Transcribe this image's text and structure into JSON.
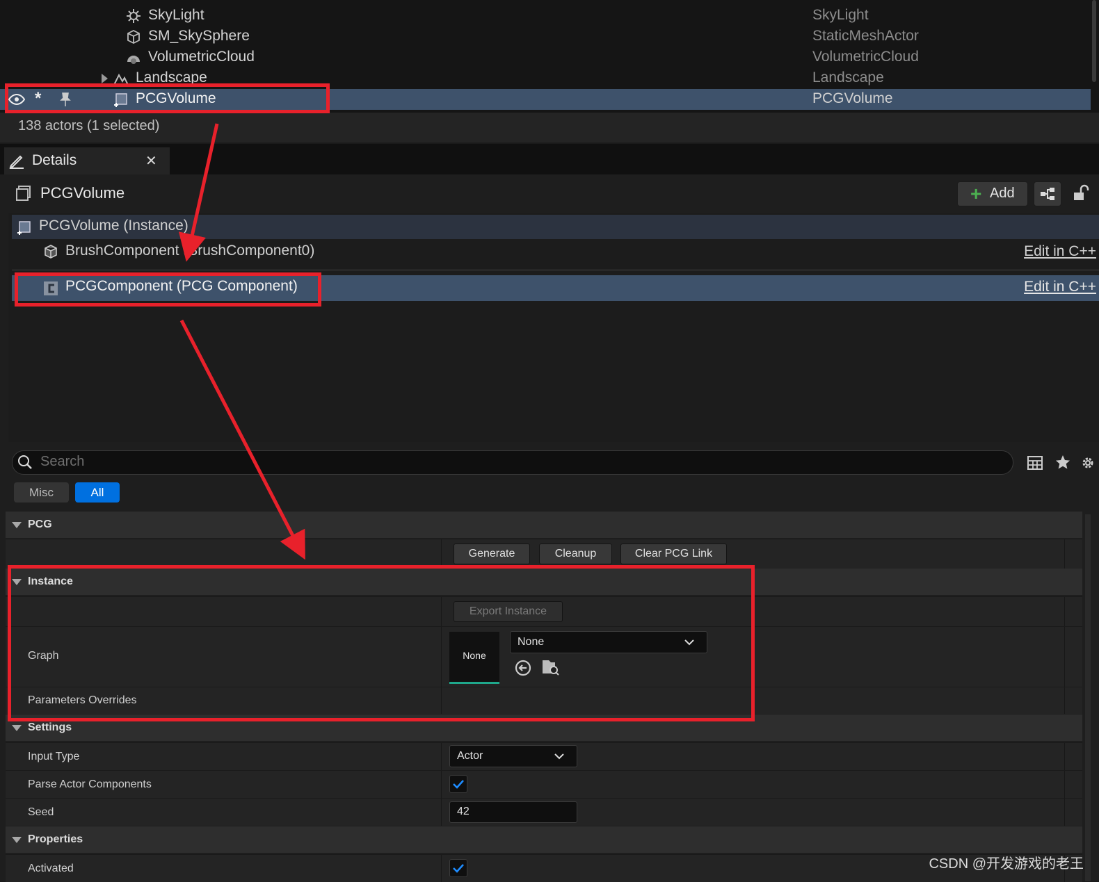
{
  "outliner": {
    "rows": [
      {
        "name": "SkyLight",
        "type": "SkyLight",
        "icon": "skylight-icon"
      },
      {
        "name": "SM_SkySphere",
        "type": "StaticMeshActor",
        "icon": "static-mesh-icon"
      },
      {
        "name": "VolumetricCloud",
        "type": "VolumetricCloud",
        "icon": "cloud-icon"
      },
      {
        "name": "Landscape",
        "type": "Landscape",
        "icon": "landscape-icon"
      },
      {
        "name": "PCGVolume",
        "type": "PCGVolume",
        "icon": "pcg-volume-icon",
        "selected": true
      }
    ],
    "status": "138 actors (1 selected)"
  },
  "details": {
    "tab_label": "Details",
    "actor_name": "PCGVolume",
    "add_label": "Add",
    "components": [
      {
        "label": "PCGVolume (Instance)"
      },
      {
        "label": "BrushComponent (BrushComponent0)",
        "edit": "Edit in C++"
      },
      {
        "label": "PCGComponent (PCG Component)",
        "edit": "Edit in C++",
        "selected": true
      }
    ],
    "search_placeholder": "Search",
    "filters": [
      "Misc",
      "All"
    ],
    "active_filter": "All"
  },
  "properties": {
    "pcg": {
      "category": "PCG",
      "buttons": [
        "Generate",
        "Cleanup",
        "Clear PCG Link"
      ]
    },
    "instance": {
      "category": "Instance",
      "export_label": "Export Instance",
      "graph_label": "Graph",
      "graph_thumb": "None",
      "graph_value": "None",
      "overrides_label": "Parameters Overrides"
    },
    "settings": {
      "category": "Settings",
      "input_type_label": "Input Type",
      "input_type_value": "Actor",
      "parse_label": "Parse Actor Components",
      "parse_checked": true,
      "seed_label": "Seed",
      "seed_value": "42"
    },
    "properties": {
      "category": "Properties",
      "activated_label": "Activated",
      "activated_checked": true
    }
  },
  "watermark": "CSDN @开发游戏的老王",
  "colors": {
    "accent": "#0070e0",
    "selection": "#3e526b",
    "highlight": "#e8212b"
  }
}
